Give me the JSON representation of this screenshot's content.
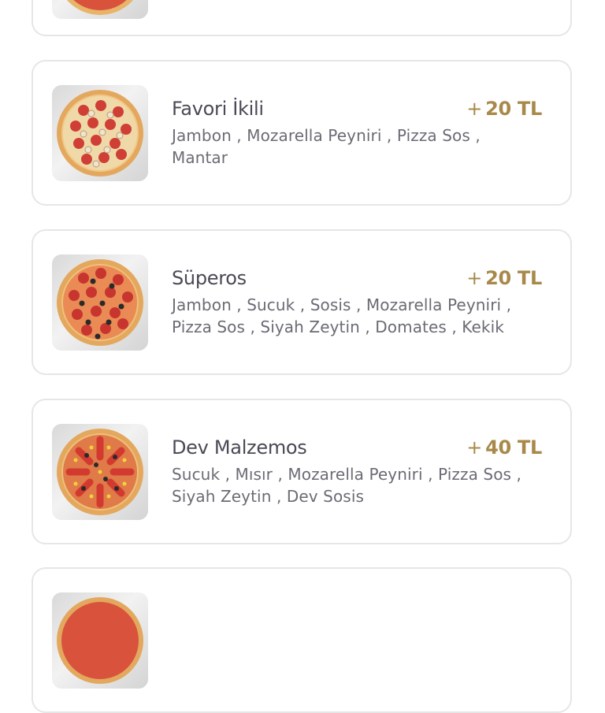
{
  "items": [
    {
      "name": "Favori İkili",
      "price_sign": "+",
      "price": "20 TL",
      "ingredients_line1": "Jambon , Mozarella Peyniri , Pizza Sos ,",
      "ingredients_line2": "Mantar"
    },
    {
      "name": "Süperos",
      "price_sign": "+",
      "price": "20 TL",
      "ingredients_line1": "Jambon , Sucuk , Sosis , Mozarella Peyniri ,",
      "ingredients_line2": "Pizza Sos , Siyah Zeytin , Domates , Kekik"
    },
    {
      "name": "Dev Malzemos",
      "price_sign": "+",
      "price": "40 TL",
      "ingredients_line1": "Sucuk , Mısır , Mozarella Peyniri , Pizza Sos ,",
      "ingredients_line2": "Siyah Zeytin , Dev Sosis"
    }
  ],
  "colors": {
    "price": "#a8894a",
    "title": "#4a4a56",
    "description": "#6b6b75",
    "card_border": "#e6e6e6"
  }
}
